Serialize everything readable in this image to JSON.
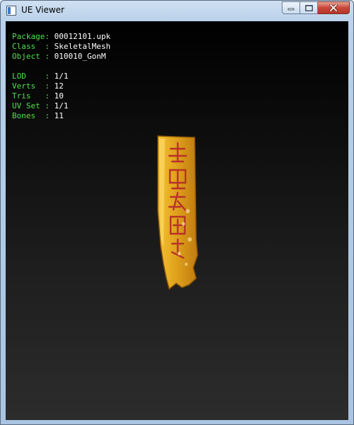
{
  "window": {
    "title": "UE Viewer",
    "controls": {
      "minimize": "minimize-icon",
      "maximize": "maximize-icon",
      "close": "close-icon"
    }
  },
  "info": {
    "package": {
      "label": "Package: ",
      "value": "00012101.upk"
    },
    "class": {
      "label": "Class  : ",
      "value": "SkeletalMesh"
    },
    "object": {
      "label": "Object : ",
      "value": "010010_GonM"
    },
    "lod": {
      "label": "LOD    : ",
      "value": "1/1"
    },
    "verts": {
      "label": "Verts  : ",
      "value": "12"
    },
    "tris": {
      "label": "Tris   : ",
      "value": "10"
    },
    "uvset": {
      "label": "UV Set : ",
      "value": "1/1"
    },
    "bones": {
      "label": "Bones  : ",
      "value": "11"
    }
  },
  "colors": {
    "label": "#4ee04e",
    "value": "#ffffff",
    "talisman_gold": "#e0a21c",
    "talisman_glyph": "#b8322a"
  },
  "viewport": {
    "object_icon": "yellow-talisman-mesh"
  }
}
